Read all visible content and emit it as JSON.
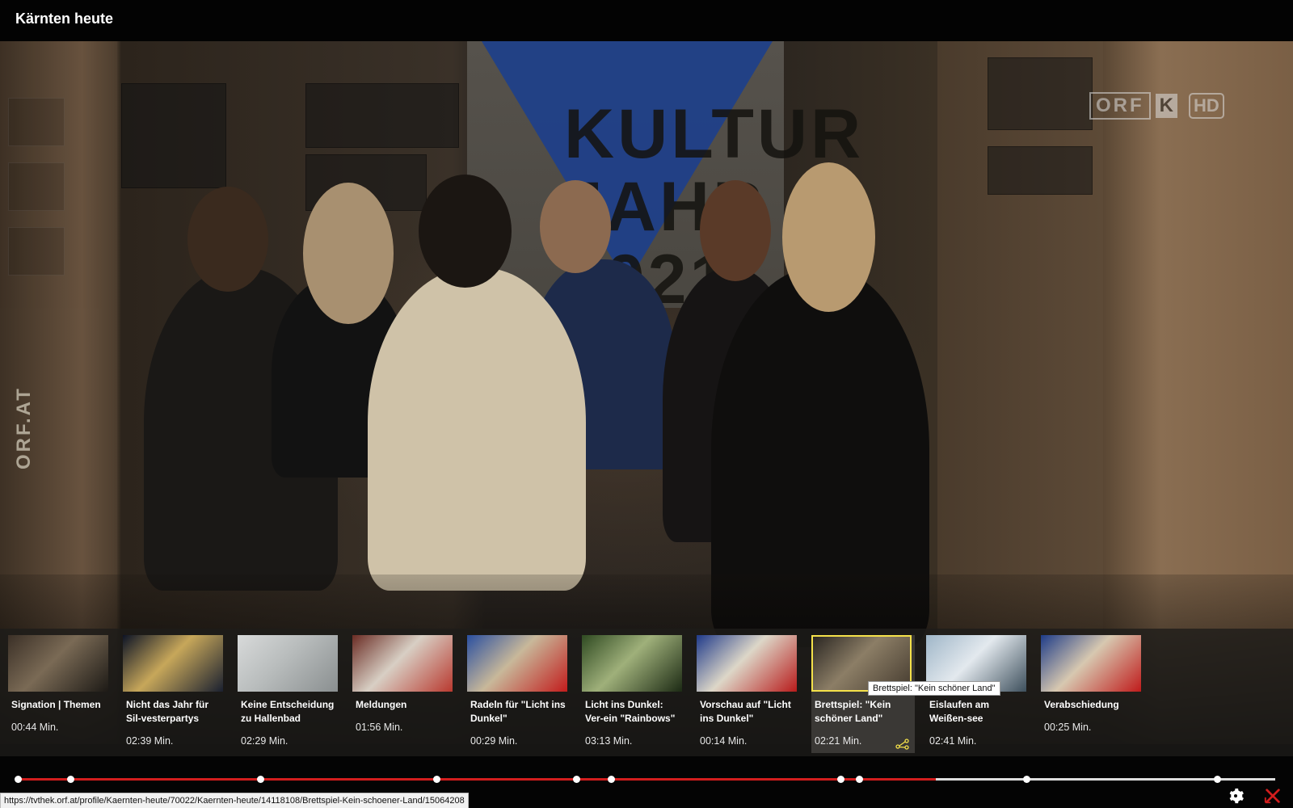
{
  "window": {
    "title": "Kärnten heute"
  },
  "video": {
    "watermark_channel": "ORF",
    "watermark_region": "K",
    "watermark_quality": "HD",
    "side_watermark": "ORF.AT",
    "poster_text": "KULTUR JAHR 2021"
  },
  "chapters": [
    {
      "title": "Signation | Themen",
      "duration": "00:44 Min.",
      "thumb": [
        "#3b3027",
        "#7a6a55",
        "#1d1a16"
      ]
    },
    {
      "title": "Nicht das Jahr für Sil-vesterpartys",
      "duration": "02:39 Min.",
      "thumb": [
        "#0d1426",
        "#c7a75a",
        "#1a2030"
      ]
    },
    {
      "title": "Keine Entscheidung zu Hallenbad",
      "duration": "02:29 Min.",
      "thumb": [
        "#d8dada",
        "#b8bcbc",
        "#8a8f90"
      ]
    },
    {
      "title": "Meldungen",
      "duration": "01:56 Min.",
      "thumb": [
        "#6a2c24",
        "#d8cfc4",
        "#b9392f"
      ]
    },
    {
      "title": "Radeln für \"Licht ins Dunkel\"",
      "duration": "00:29 Min.",
      "thumb": [
        "#2a4fa0",
        "#c8b89a",
        "#c21c1c"
      ]
    },
    {
      "title": "Licht ins Dunkel: Ver-ein \"Rainbows\"",
      "duration": "03:13 Min.",
      "thumb": [
        "#2f4a22",
        "#9fb07a",
        "#1c2a14"
      ]
    },
    {
      "title": "Vorschau auf \"Licht ins Dunkel\"",
      "duration": "00:14 Min.",
      "thumb": [
        "#1f3a8a",
        "#ddd7c8",
        "#b81b1b"
      ]
    },
    {
      "title": "Brettspiel: \"Kein schöner Land\"",
      "duration": "02:21 Min.",
      "thumb": [
        "#2a2622",
        "#8c7e66",
        "#463c30"
      ]
    },
    {
      "title": "Eislaufen am Weißen-see",
      "duration": "02:41 Min.",
      "thumb": [
        "#9fb6c8",
        "#e3e9ee",
        "#3d4f5c"
      ]
    },
    {
      "title": "Verabschiedung",
      "duration": "00:25 Min.",
      "thumb": [
        "#1e3c88",
        "#d7c8b0",
        "#c01b1b"
      ]
    }
  ],
  "active_chapter_index": 7,
  "tooltip": "Brettspiel: \"Kein schöner Land\"",
  "timeline": {
    "progress": 0.73,
    "chapter_markers": [
      0.0,
      0.042,
      0.193,
      0.333,
      0.444,
      0.472,
      0.654,
      0.669,
      0.802,
      0.954
    ]
  },
  "status_url": "https://tvthek.orf.at/profile/Kaernten-heute/70022/Kaernten-heute/14118108/Brettspiel-Kein-schoener-Land/15064208",
  "controls": {
    "settings_icon": "gear-icon",
    "close_icon": "close-icon"
  },
  "colors": {
    "accent": "#d21d1d",
    "active_border": "#f4e14a"
  }
}
